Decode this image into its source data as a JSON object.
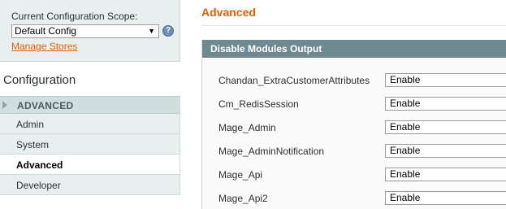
{
  "scope": {
    "label": "Current Configuration Scope:",
    "selected": "Default Config",
    "arrow": "▼",
    "help": "?",
    "manage_link": "Manage Stores"
  },
  "sidebar": {
    "title": "Configuration",
    "section": "ADVANCED",
    "items": [
      {
        "label": "Admin"
      },
      {
        "label": "System"
      },
      {
        "label": "Advanced"
      },
      {
        "label": "Developer"
      }
    ]
  },
  "main": {
    "title": "Advanced",
    "panel_title": "Disable Modules Output",
    "rows": [
      {
        "label": "Chandan_ExtraCustomerAttributes",
        "value": "Enable"
      },
      {
        "label": "Cm_RedisSession",
        "value": "Enable"
      },
      {
        "label": "Mage_Admin",
        "value": "Enable"
      },
      {
        "label": "Mage_AdminNotification",
        "value": "Enable"
      },
      {
        "label": "Mage_Api",
        "value": "Enable"
      },
      {
        "label": "Mage_Api2",
        "value": "Enable"
      }
    ]
  },
  "colors": {
    "accent": "#eb5e00",
    "panel_header": "#6f8992",
    "sidebar_bg": "#e7efef"
  }
}
